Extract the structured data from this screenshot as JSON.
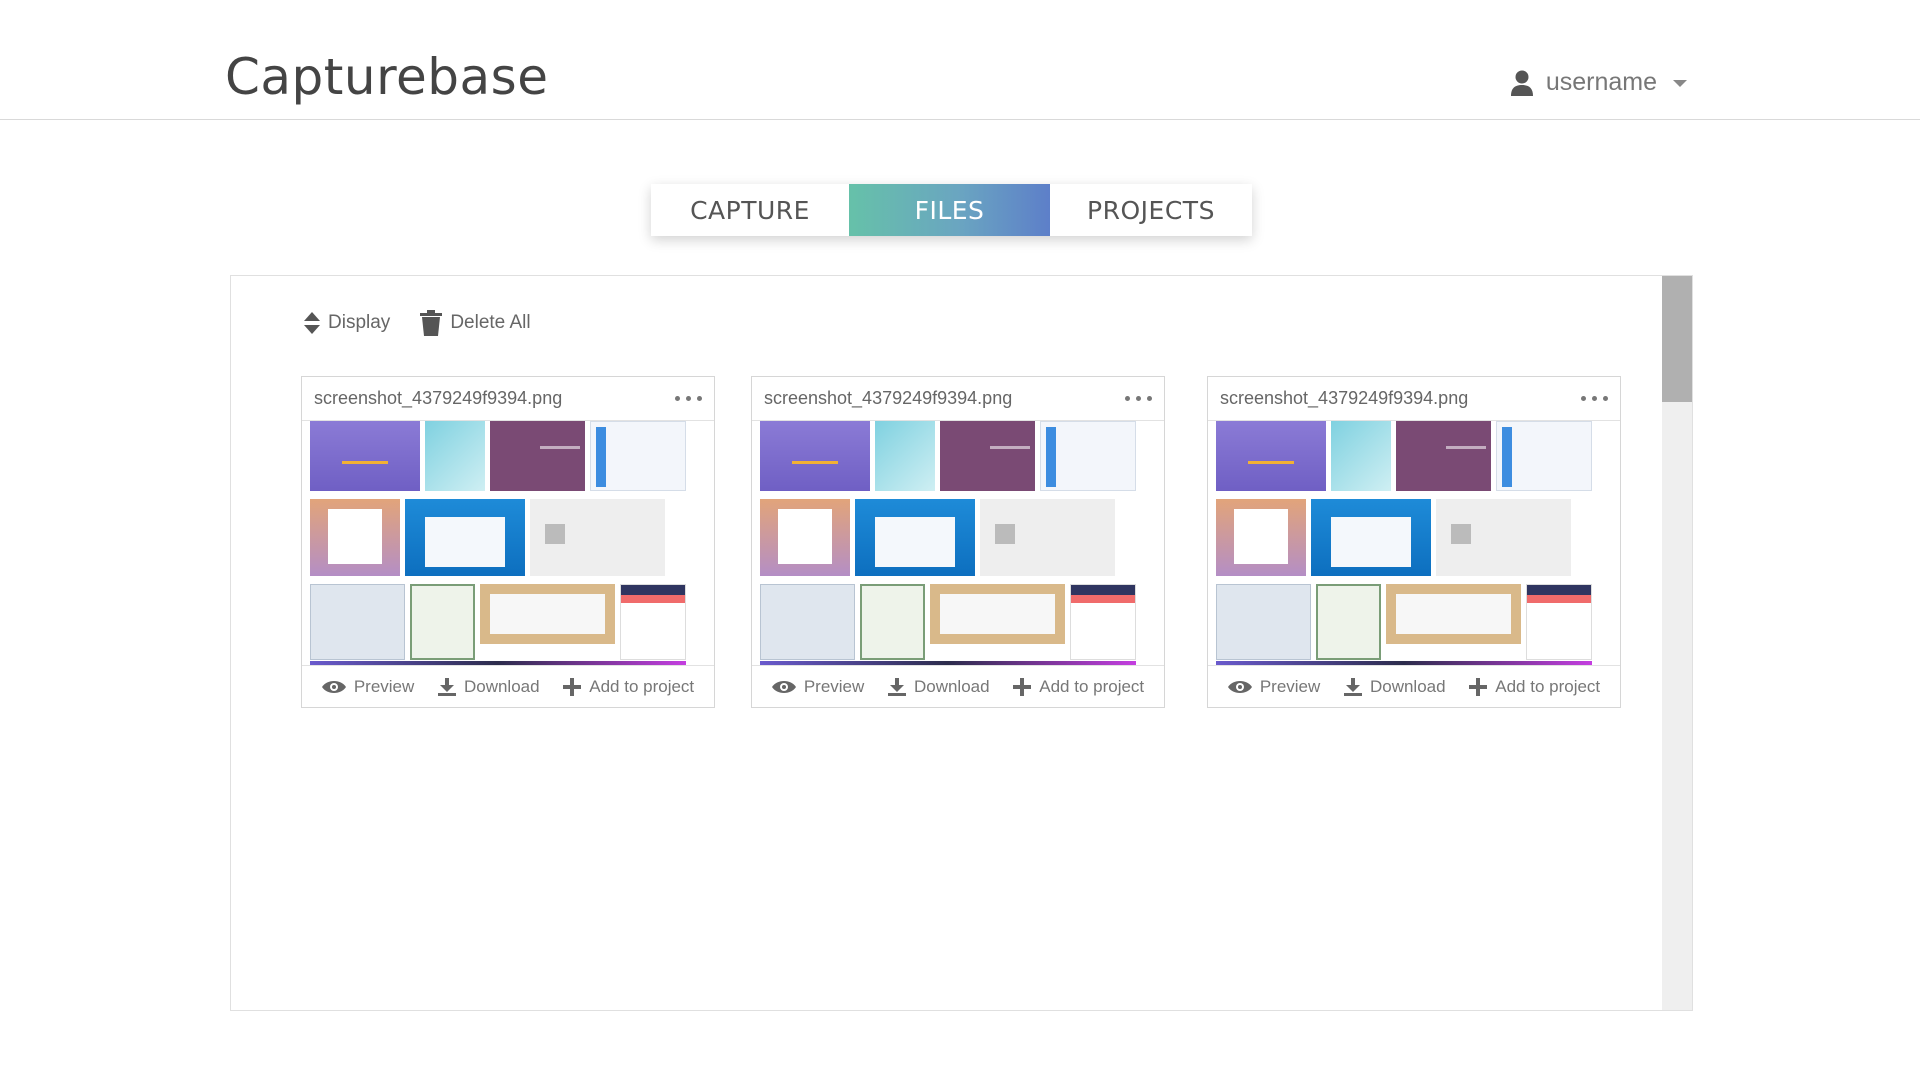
{
  "app": {
    "title": "Capturebase"
  },
  "user": {
    "name": "username"
  },
  "tabs": [
    {
      "label": "CAPTURE",
      "active": false
    },
    {
      "label": "FILES",
      "active": true
    },
    {
      "label": "PROJECTS",
      "active": false
    }
  ],
  "toolbar": {
    "display_label": "Display",
    "delete_all_label": "Delete All"
  },
  "files": [
    {
      "filename": "screenshot_4379249f9394.png"
    },
    {
      "filename": "screenshot_4379249f9394.png"
    },
    {
      "filename": "screenshot_4379249f9394.png"
    }
  ],
  "actions": {
    "preview": "Preview",
    "download": "Download",
    "add_to_project": "Add to project"
  },
  "colors": {
    "tab_gradient_start": "#66c1a9",
    "tab_gradient_end": "#5d7fc9",
    "scrollbar_thumb": "#b0b0b0"
  }
}
